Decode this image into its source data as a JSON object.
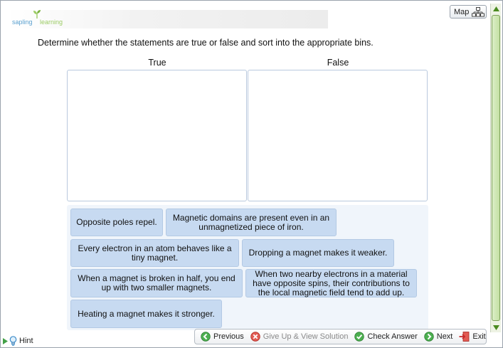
{
  "header": {
    "logo": {
      "word_a": "sapling",
      "word_b": "learning"
    },
    "map_label": "Map"
  },
  "question": "Determine whether the statements are true or false and sort into the appropriate bins.",
  "bins": {
    "true_label": "True",
    "false_label": "False"
  },
  "cards": [
    "Opposite poles repel.",
    "Magnetic domains are present even in an unmagnetized piece of iron.",
    "Every electron in an atom behaves like a tiny magnet.",
    "Dropping a magnet makes it weaker.",
    "When a magnet is broken in half, you end up with two smaller magnets.",
    "When two nearby electrons in a material have opposite spins, their contributions to the local magnetic field tend to add up.",
    "Heating a magnet makes it stronger."
  ],
  "footer": {
    "hint_label": "Hint",
    "previous_label": "Previous",
    "give_up_label": "Give Up & View Solution",
    "check_answer_label": "Check Answer",
    "next_label": "Next",
    "exit_label": "Exit"
  },
  "icons": {
    "map": "map-tree-icon",
    "hint": "lightbulb-icon",
    "previous": "previous-arrow-icon",
    "give_up": "give-up-x-icon",
    "check": "check-icon",
    "next": "next-arrow-icon",
    "exit": "exit-door-icon"
  },
  "colors": {
    "card_bg": "#c7daf1",
    "pool_bg": "#f0f5fb",
    "bin_border": "#b9c9de",
    "scrollbar_green": "#c4e0a4",
    "nav_green": "#4caf50",
    "give_up_red": "#d9342b"
  }
}
